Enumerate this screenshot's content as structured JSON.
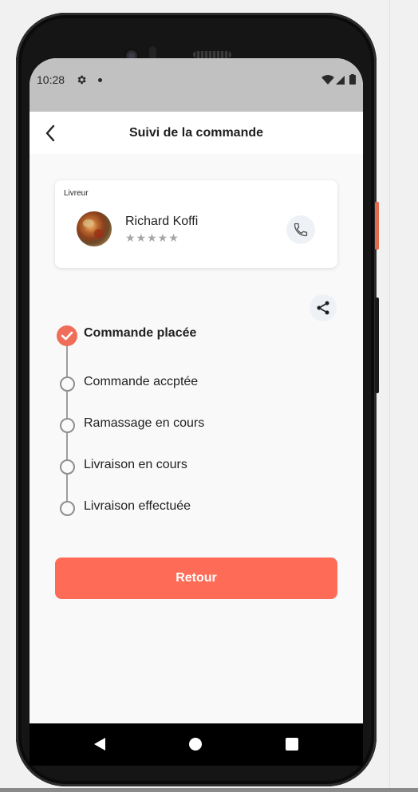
{
  "status_bar": {
    "time": "10:28"
  },
  "app_bar": {
    "title": "Suivi de la commande"
  },
  "driver_card": {
    "label": "Livreur",
    "name": "Richard Koffi",
    "rating": 0,
    "stars": "★★★★★"
  },
  "timeline": {
    "steps": [
      {
        "label": "Commande placée",
        "done": true
      },
      {
        "label": "Commande accptée",
        "done": false
      },
      {
        "label": "Ramassage en cours",
        "done": false
      },
      {
        "label": "Livraison en cours",
        "done": false
      },
      {
        "label": "Livraison effectuée",
        "done": false
      }
    ]
  },
  "actions": {
    "retour_label": "Retour"
  },
  "colors": {
    "accent": "#fe6b57",
    "check": "#ef6e5a",
    "star_inactive": "#a6a6a6"
  },
  "icons": {
    "back": "chevron-left-icon",
    "call": "phone-icon",
    "share": "share-icon",
    "step_done": "check-circle-icon",
    "step_pending": "circle-outline-icon"
  }
}
